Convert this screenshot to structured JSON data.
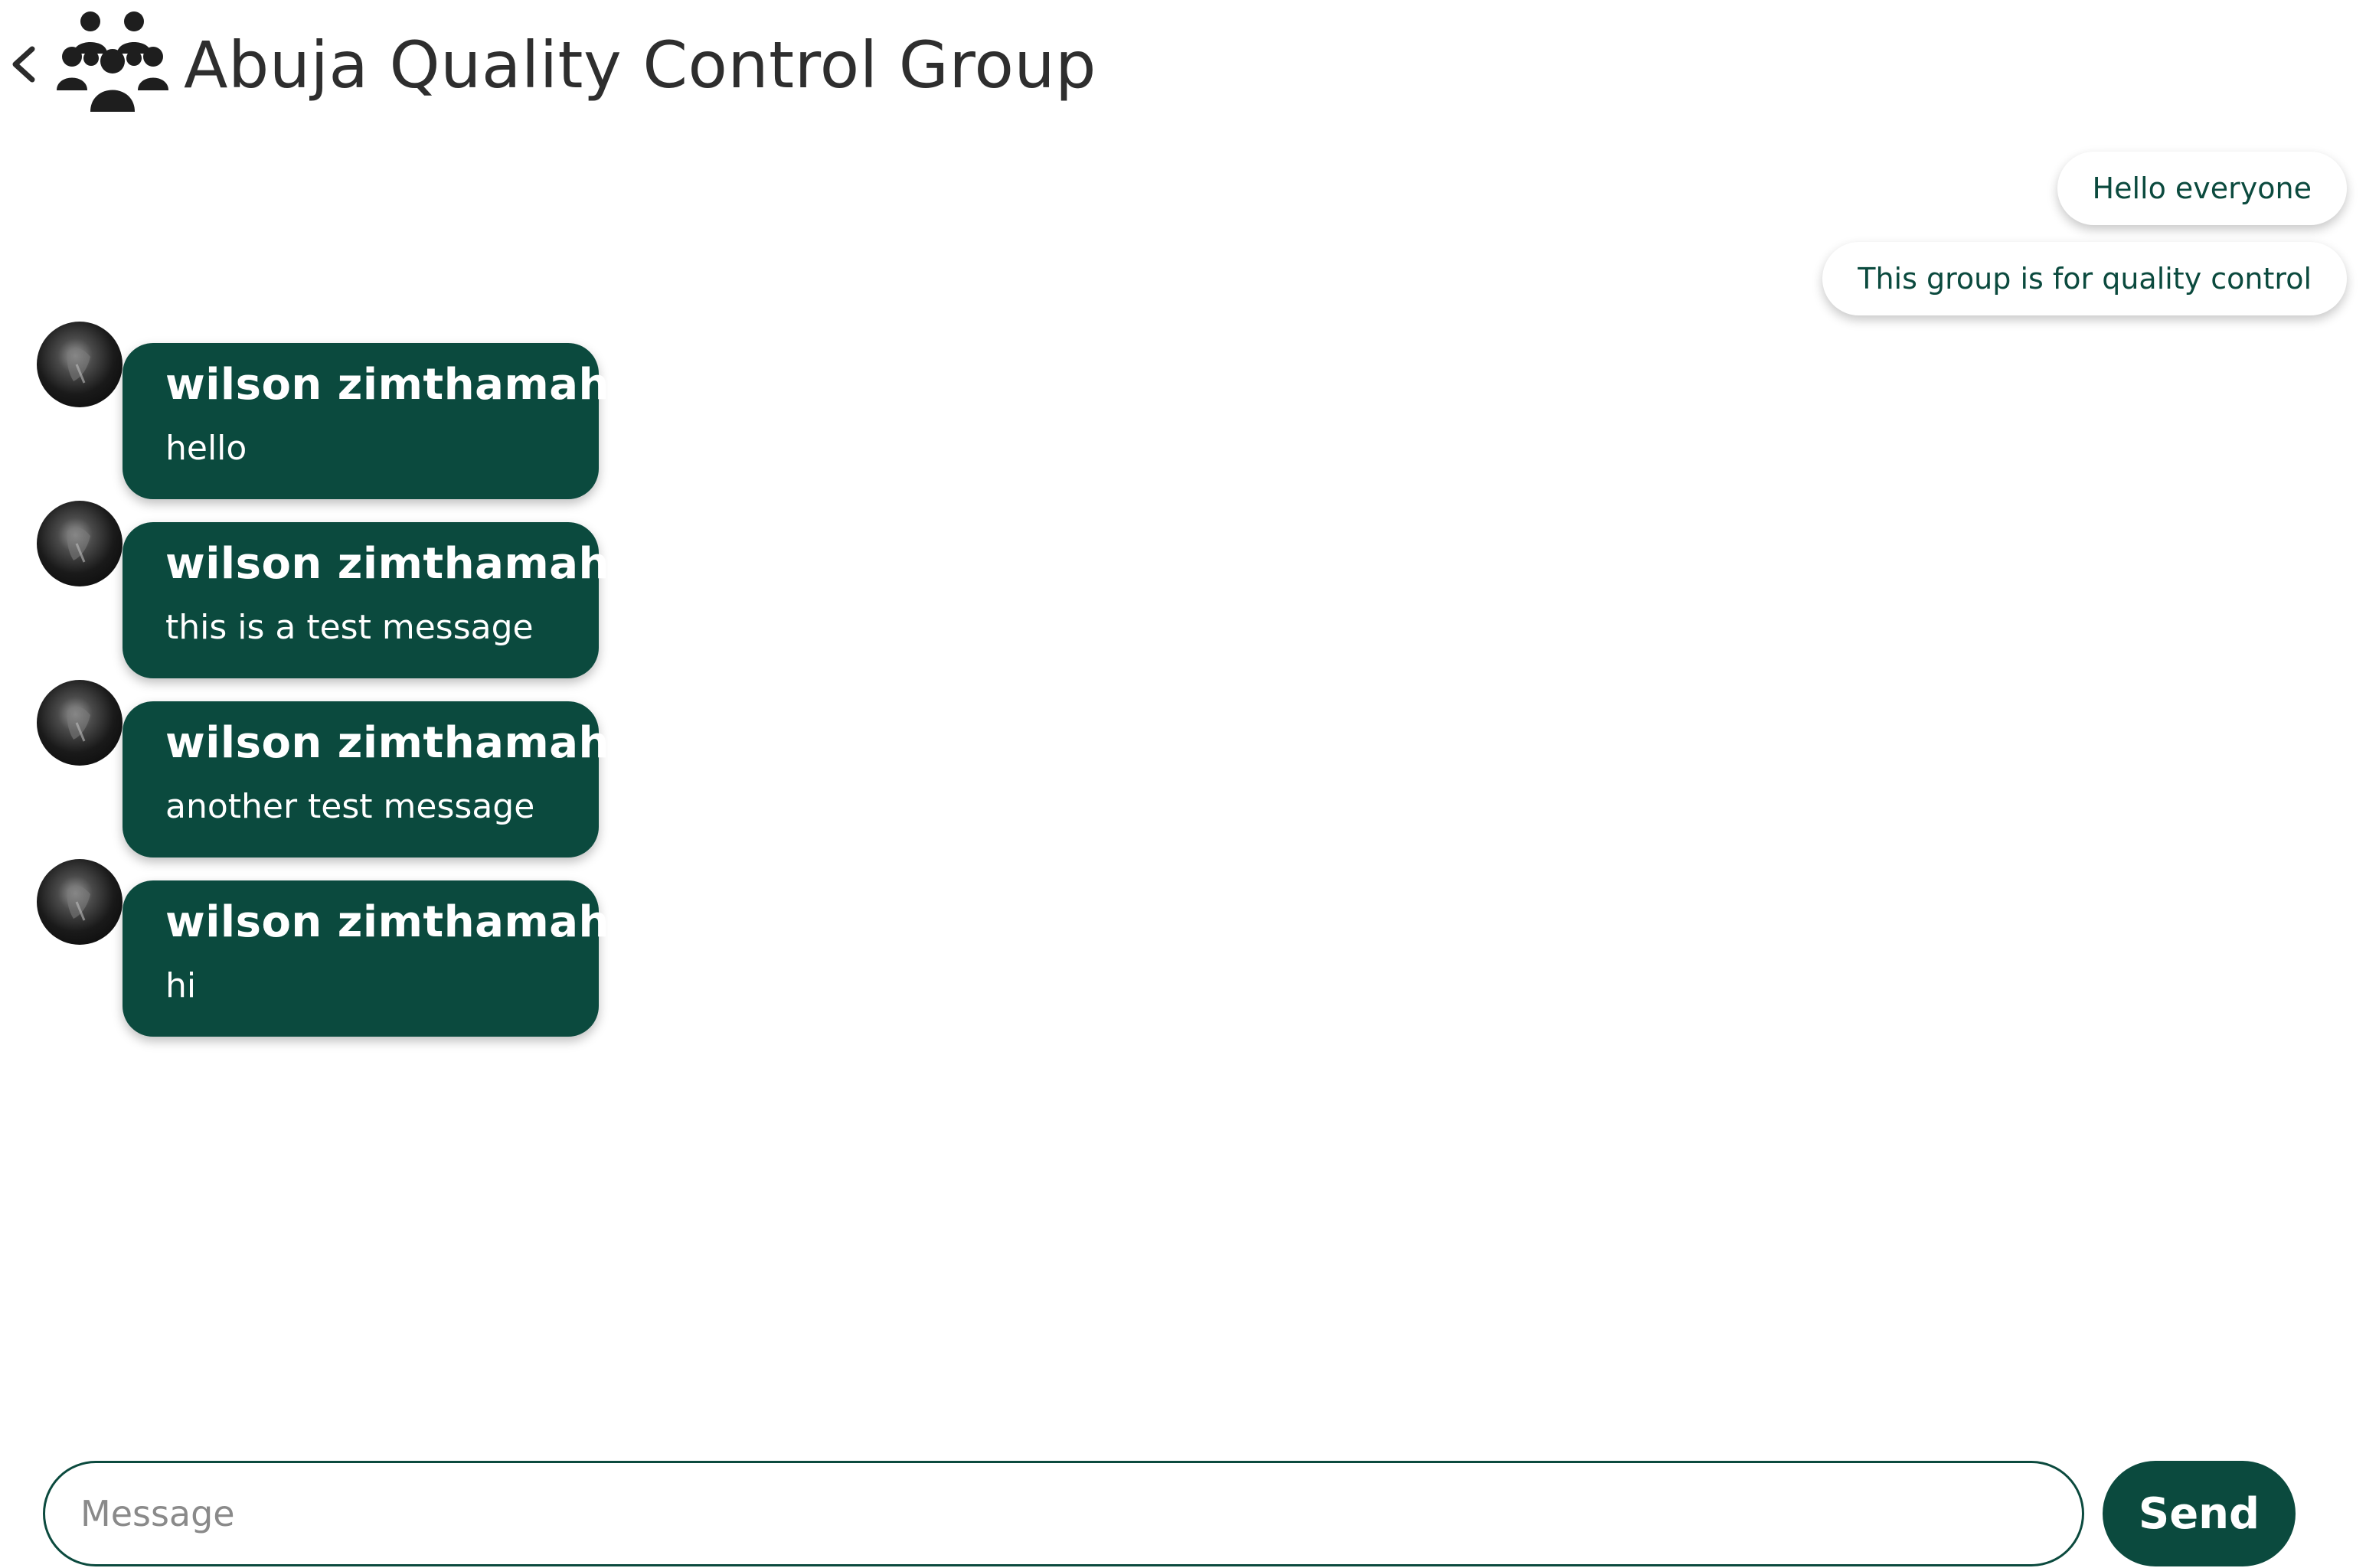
{
  "header": {
    "back_icon": "chevron-left-icon",
    "group_icon": "people-group-icon",
    "title": "Abuja Quality Control Group"
  },
  "colors": {
    "accent": "#0b4a3e",
    "outgoing_bubble_bg": "#ffffff",
    "outgoing_text": "#0b4a3e",
    "incoming_text": "#ffffff"
  },
  "messages": {
    "outgoing": [
      {
        "text": "Hello everyone"
      },
      {
        "text": "This group is for quality control"
      }
    ],
    "incoming": [
      {
        "sender": "wilson zimthamah",
        "text": "hello"
      },
      {
        "sender": "wilson zimthamah",
        "text": "this is a test message"
      },
      {
        "sender": "wilson zimthamah",
        "text": "another test message"
      },
      {
        "sender": "wilson zimthamah",
        "text": "hi"
      }
    ]
  },
  "composer": {
    "placeholder": "Message",
    "value": "",
    "send_label": "Send"
  }
}
